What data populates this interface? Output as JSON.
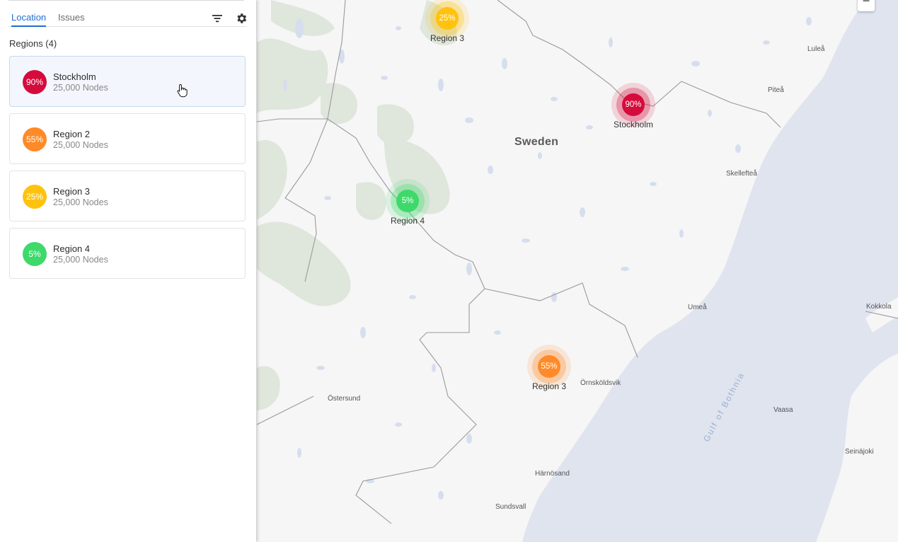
{
  "tabs": [
    {
      "label": "Location",
      "active": true
    },
    {
      "label": "Issues",
      "active": false
    }
  ],
  "toolbar": {
    "filter_icon": "filter-icon",
    "settings_icon": "gear-icon"
  },
  "regions": {
    "heading": "Regions (4)",
    "items": [
      {
        "name": "Stockholm",
        "percent": "90%",
        "nodes": "25,000 Nodes",
        "color": "#d50b3c",
        "selected": true
      },
      {
        "name": "Region 2",
        "percent": "55%",
        "nodes": "25,000 Nodes",
        "color": "#ff8a27"
      },
      {
        "name": "Region 3",
        "percent": "25%",
        "nodes": "25,000 Nodes",
        "color": "#ffc20e"
      },
      {
        "name": "Region 4",
        "percent": "5%",
        "nodes": "25,000 Nodes",
        "color": "#3ed96b"
      }
    ]
  },
  "map": {
    "country_label": "Sweden",
    "sea_label": "Gulf of Bothnia",
    "places": [
      "Luleå",
      "Piteå",
      "Skellefteå",
      "Umeå",
      "Kokkola",
      "Örnsköldsvik",
      "Östersund",
      "Vaasa",
      "Seinäjoki",
      "Härnösand",
      "Sundsvall"
    ],
    "markers": [
      {
        "percent": "25%",
        "label": "Region 3",
        "color": "#ffc20e"
      },
      {
        "percent": "90%",
        "label": "Stockholm",
        "color": "#d50b3c"
      },
      {
        "percent": "5%",
        "label": "Region 4",
        "color": "#3ed96b"
      },
      {
        "percent": "55%",
        "label": "Region 3",
        "color": "#ff8a27"
      }
    ],
    "zoom_out_label": "−"
  }
}
